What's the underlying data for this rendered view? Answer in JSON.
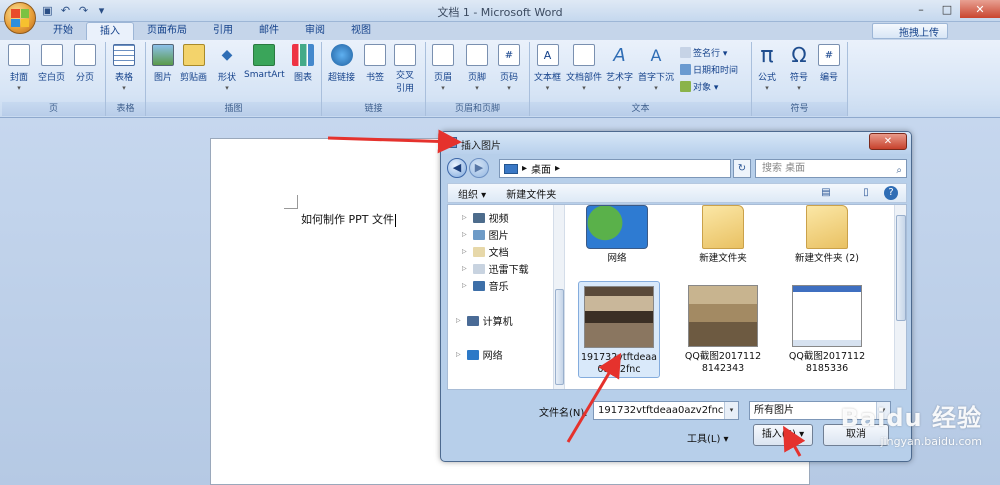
{
  "window": {
    "title": "文档 1 - Microsoft Word",
    "qat": [
      "save-icon",
      "undo-icon",
      "redo-icon",
      "customize-icon"
    ]
  },
  "tabs": [
    "开始",
    "插入",
    "页面布局",
    "引用",
    "邮件",
    "审阅",
    "视图"
  ],
  "cloud_upload_label": "拖拽上传",
  "ribbon": {
    "groups": [
      {
        "label": "页",
        "buttons": [
          "封面",
          "空白页",
          "分页"
        ]
      },
      {
        "label": "表格",
        "buttons": [
          "表格"
        ]
      },
      {
        "label": "插图",
        "buttons": [
          "图片",
          "剪贴画",
          "形状",
          "SmartArt",
          "图表"
        ]
      },
      {
        "label": "链接",
        "buttons": [
          "超链接",
          "书签",
          "交叉\n引用"
        ]
      },
      {
        "label": "页眉和页脚",
        "buttons": [
          "页眉",
          "页脚",
          "页码"
        ]
      },
      {
        "label": "文本",
        "buttons": [
          "文本框",
          "文档部件",
          "艺术字",
          "首字下沉"
        ],
        "small": [
          "签名行 ▾",
          "日期和时间",
          "对象 ▾"
        ]
      },
      {
        "label": "符号",
        "buttons": [
          "公式",
          "符号",
          "编号"
        ]
      }
    ]
  },
  "document": {
    "text": "如何制作 PPT 文件"
  },
  "dialog": {
    "title": "插入图片",
    "address": "桌面",
    "address_sep": "▸",
    "search_placeholder": "搜索 桌面",
    "toolbar": {
      "organize": "组织 ▾",
      "new_folder": "新建文件夹"
    },
    "nav": [
      "视频",
      "图片",
      "文档",
      "迅雷下载",
      "音乐",
      "计算机",
      "网络"
    ],
    "files": [
      {
        "name": "网络"
      },
      {
        "name": "新建文件夹"
      },
      {
        "name": "新建文件夹 (2)"
      },
      {
        "name": "191732vtftdeaa0azv2fnc",
        "selected": true
      },
      {
        "name": "QQ截图20171128142343"
      },
      {
        "name": "QQ截图20171128185336"
      }
    ],
    "filename_label": "文件名(N):",
    "filename_value": "191732vtftdeaa0azv2fnc",
    "filetype_value": "所有图片",
    "tools_label": "工具(L)",
    "insert_label": "插入(S)",
    "cancel_label": "取消"
  },
  "watermark": {
    "brand": "Baidu 经验",
    "url": "jingyan.baidu.com"
  },
  "colors": {
    "accent": "#15428b",
    "arrow": "#e5322d"
  }
}
